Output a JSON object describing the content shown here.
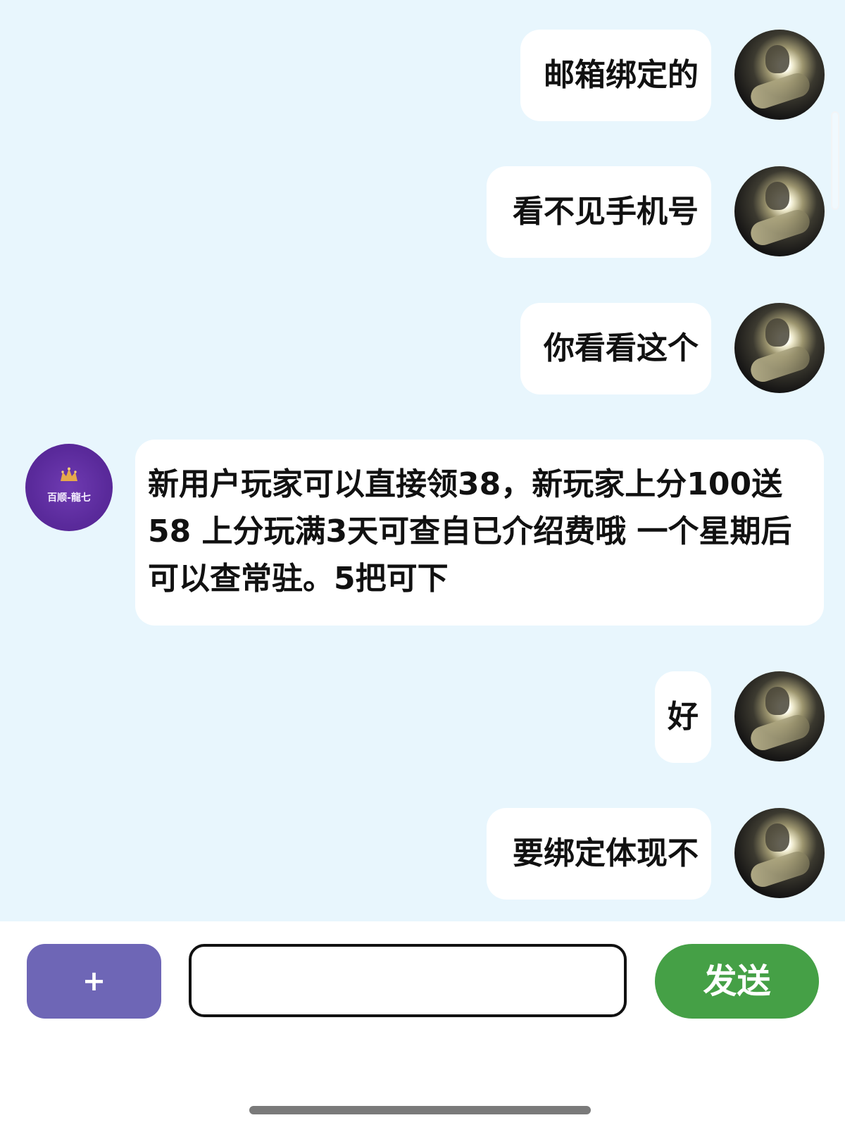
{
  "messages": [
    {
      "side": "right",
      "text": "邮箱绑定的",
      "avatar": "user-photo-avatar"
    },
    {
      "side": "right",
      "text": "看不见手机号",
      "avatar": "user-photo-avatar"
    },
    {
      "side": "right",
      "text": "你看看这个",
      "avatar": "user-photo-avatar"
    },
    {
      "side": "left",
      "text": "新用户玩家可以直接领38，新玩家上分100送58 上分玩满3天可查自已介绍费哦 一个星期后可以查常驻。5把可下",
      "avatar": "brand-logo-avatar"
    },
    {
      "side": "right",
      "text": "好",
      "avatar": "user-photo-avatar"
    },
    {
      "side": "right",
      "text": "要绑定体现不",
      "avatar": "user-photo-avatar"
    }
  ],
  "brand_avatar_text": "百顺-龍七",
  "composer": {
    "plus_label": "+",
    "input_value": "",
    "send_label": "发送"
  },
  "colors": {
    "chat_background": "#e8f6fd",
    "plus_button": "#6e66b6",
    "send_button": "#45a046",
    "brand_avatar": "#5a2a9b"
  },
  "icons": {
    "crown": "crown-icon"
  }
}
